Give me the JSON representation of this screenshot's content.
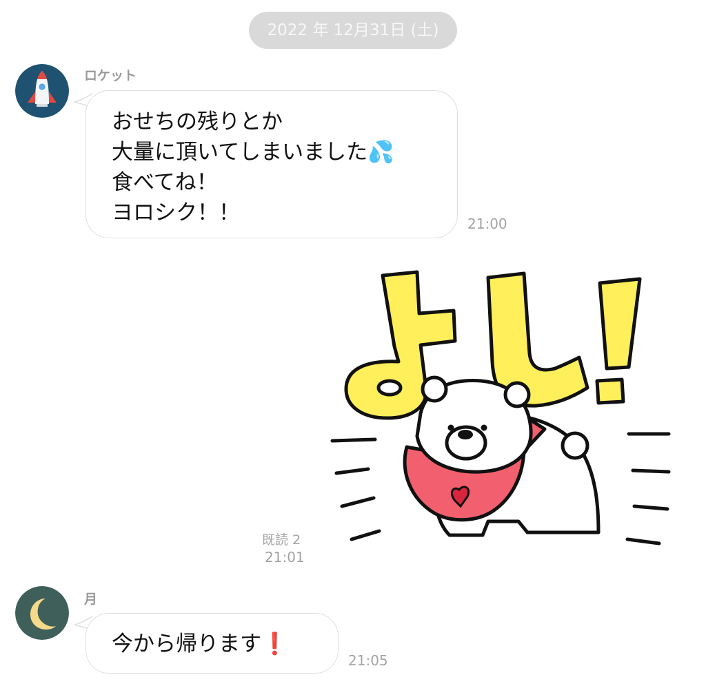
{
  "date_separator": "2022 年 12月31日 (土)",
  "messages": [
    {
      "sender": "ロケット",
      "avatar_icon": "rocket-icon",
      "lines": [
        "おせちの残りとか",
        "大量に頂いてしまいました💦",
        "食べてね！",
        "ヨロシク！！"
      ],
      "time": "21:00"
    },
    {
      "type": "sticker",
      "sticker_text": "よし!",
      "read_status": "既読 2",
      "time": "21:01"
    },
    {
      "sender": "月",
      "avatar_icon": "moon-icon",
      "lines": [
        "今から帰ります❗"
      ],
      "time": "21:05"
    }
  ],
  "colors": {
    "rocket_avatar_bg": "#1f5270",
    "moon_avatar_bg": "#3f5f5a",
    "sticker_yellow": "#ffef5a",
    "sticker_scarf": "#f25f6e"
  }
}
